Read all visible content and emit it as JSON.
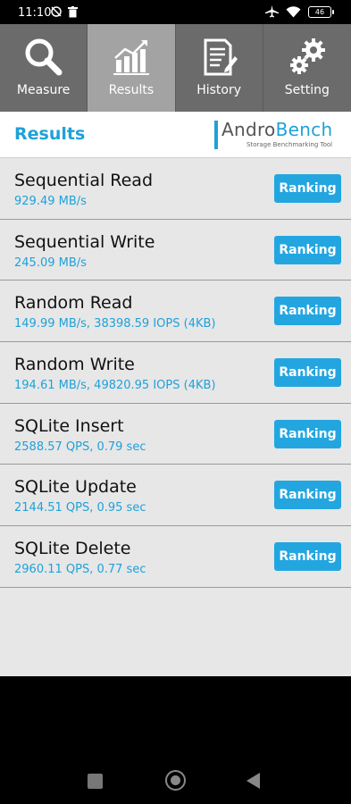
{
  "status_bar": {
    "time": "11:10",
    "battery": "46",
    "icons": [
      "no-sync-icon",
      "trash-icon",
      "airplane-icon",
      "wifi-icon",
      "battery-icon"
    ]
  },
  "tabs": [
    {
      "label": "Measure",
      "icon": "magnifier-icon",
      "active": false
    },
    {
      "label": "Results",
      "icon": "chart-icon",
      "active": true
    },
    {
      "label": "History",
      "icon": "document-icon",
      "active": false
    },
    {
      "label": "Setting",
      "icon": "gears-icon",
      "active": false
    }
  ],
  "header": {
    "title": "Results",
    "logo_andro": "Andro",
    "logo_bench": "Bench",
    "logo_sub": "Storage Benchmarking Tool"
  },
  "results": [
    {
      "name": "Sequential Read",
      "value": "929.49 MB/s",
      "button": "Ranking"
    },
    {
      "name": "Sequential Write",
      "value": "245.09 MB/s",
      "button": "Ranking"
    },
    {
      "name": "Random Read",
      "value": "149.99 MB/s, 38398.59 IOPS (4KB)",
      "button": "Ranking"
    },
    {
      "name": "Random Write",
      "value": "194.61 MB/s, 49820.95 IOPS (4KB)",
      "button": "Ranking"
    },
    {
      "name": "SQLite Insert",
      "value": "2588.57 QPS, 0.79 sec",
      "button": "Ranking"
    },
    {
      "name": "SQLite Update",
      "value": "2144.51 QPS, 0.95 sec",
      "button": "Ranking"
    },
    {
      "name": "SQLite Delete",
      "value": "2960.11 QPS, 0.77 sec",
      "button": "Ranking"
    }
  ],
  "colors": {
    "accent": "#1fa1d9",
    "button": "#23a6e0",
    "tab_bg": "#6b6b6b",
    "tab_active_bg": "#a3a3a3",
    "list_bg": "#e7e7e7"
  }
}
